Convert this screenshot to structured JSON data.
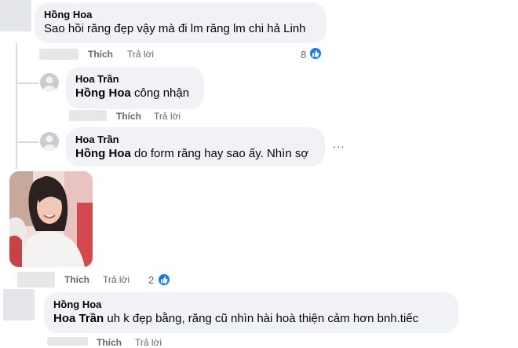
{
  "comments": [
    {
      "author": "Hồng Hoa",
      "text": "Sao hồi răng đẹp vậy mà đi lm răng lm chi hả Linh",
      "like_label": "Thích",
      "reply_label": "Trả lời",
      "reaction_count": "8"
    },
    {
      "author": "Hoa Trần",
      "mention": "Hồng Hoa",
      "text": " công nhận",
      "like_label": "Thích",
      "reply_label": "Trả lời"
    },
    {
      "author": "Hoa Trần",
      "mention": "Hồng Hoa",
      "text": " do form răng hay sao ấy. Nhìn sợ",
      "more_label": "...",
      "like_label": "Thích",
      "reply_label": "Trả lời",
      "reaction_count": "2"
    },
    {
      "author": "Hồng Hoa",
      "mention": "Hoa Trần",
      "text": " uh k đẹp bằng, răng cũ nhìn hài hoà thiện cảm hơn bnh.tiếc",
      "like_label": "Thích",
      "reply_label": "Trả lời"
    }
  ],
  "icons": {
    "reaction": "like-thumb-icon",
    "avatar": "default-user-icon",
    "more": "more-horizontal-icon"
  },
  "colors": {
    "bubble": "#f0f2f5",
    "meta": "#65676b",
    "reaction": "#1877f2"
  }
}
